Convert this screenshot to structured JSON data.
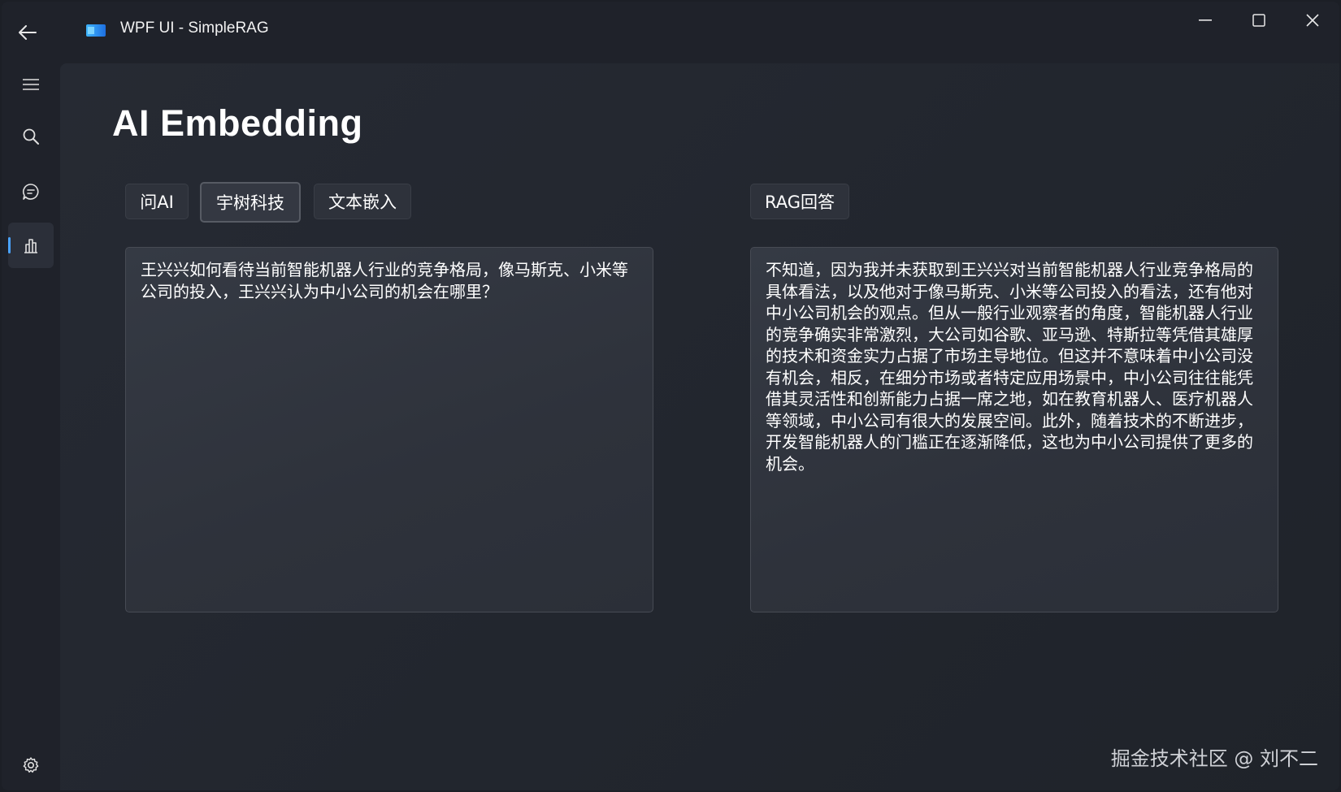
{
  "app": {
    "title": "WPF UI - SimpleRAG"
  },
  "icons": {
    "back": "arrow-left-icon",
    "logo": "wpfui-logo-icon",
    "minimize": "minimize-icon",
    "maximize": "maximize-icon",
    "close": "close-icon",
    "menu": "hamburger-menu-icon",
    "search": "search-icon",
    "chat": "chat-icon",
    "chart": "bar-chart-icon",
    "settings": "gear-icon"
  },
  "colors": {
    "accent": "#4aa3ff",
    "background": "#1f222a"
  },
  "page": {
    "title": "AI Embedding"
  },
  "buttons": {
    "ask_ai": "问AI",
    "company": "宇树科技",
    "embed": "文本嵌入",
    "rag": "RAG回答"
  },
  "question": {
    "text": "王兴兴如何看待当前智能机器人行业的竞争格局，像马斯克、小米等公司的投入，王兴兴认为中小公司的机会在哪里？"
  },
  "answer": {
    "text": "不知道，因为我并未获取到王兴兴对当前智能机器人行业竞争格局的具体看法，以及他对于像马斯克、小米等公司投入的看法，还有他对中小公司机会的观点。但从一般行业观察者的角度，智能机器人行业的竞争确实非常激烈，大公司如谷歌、亚马逊、特斯拉等凭借其雄厚的技术和资金实力占据了市场主导地位。但这并不意味着中小公司没有机会，相反，在细分市场或者特定应用场景中，中小公司往往能凭借其灵活性和创新能力占据一席之地，如在教育机器人、医疗机器人等领域，中小公司有很大的发展空间。此外，随着技术的不断进步，开发智能机器人的门槛正在逐渐降低，这也为中小公司提供了更多的机会。"
  },
  "watermark": "掘金技术社区 @ 刘不二"
}
